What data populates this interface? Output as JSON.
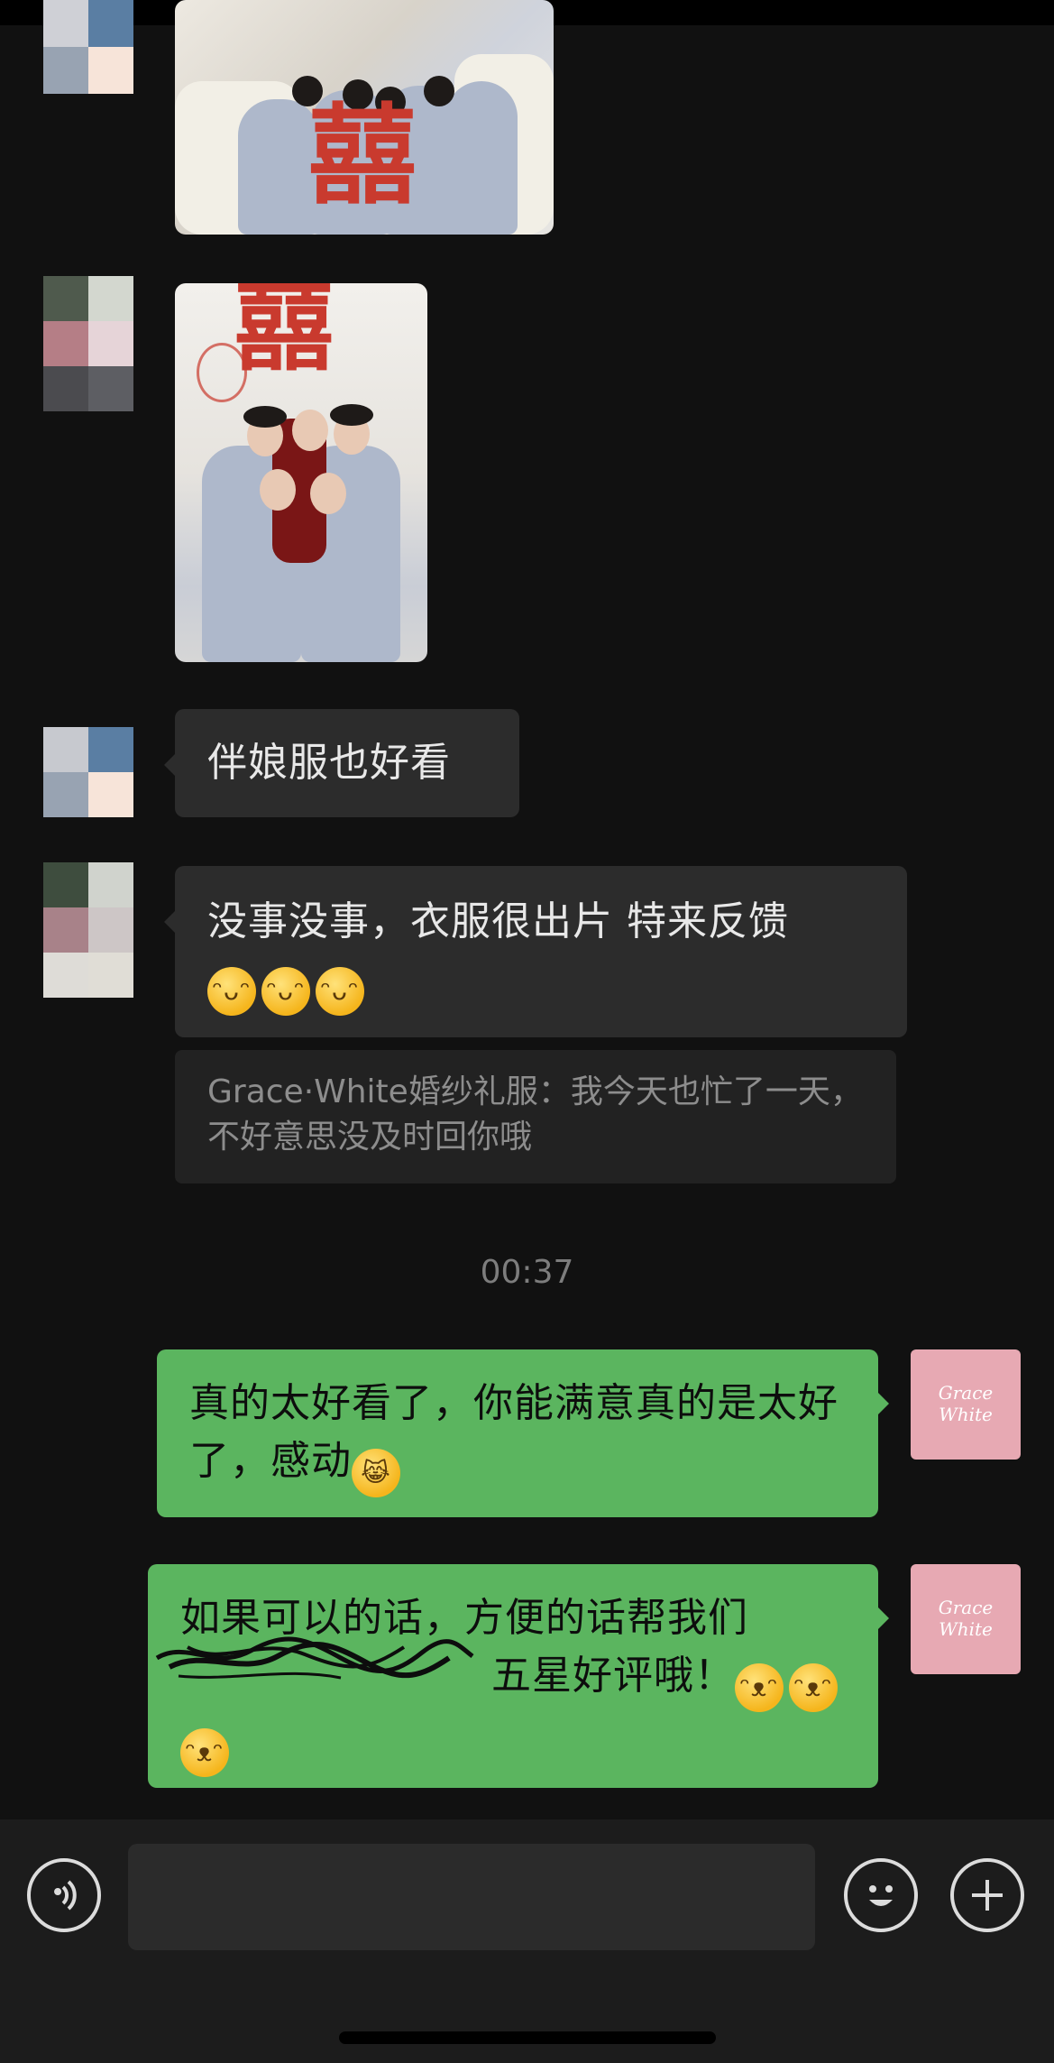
{
  "chat": {
    "messages": [
      {
        "type": "image",
        "from": "other"
      },
      {
        "type": "image",
        "from": "other"
      },
      {
        "type": "text",
        "from": "other",
        "text": "伴娘服也好看"
      },
      {
        "type": "text",
        "from": "other",
        "text": "没事没事，衣服很出片 特来反馈",
        "emoji": [
          "grin",
          "grin",
          "grin"
        ]
      },
      {
        "type": "quote",
        "from": "other",
        "text": "Grace·White婚纱礼服：我今天也忙了一天，不好意思没及时回你哦"
      },
      {
        "type": "timestamp",
        "text": "00:37"
      },
      {
        "type": "text",
        "from": "me",
        "text": "真的太好看了，你能满意真的是太好了，感动",
        "emoji": [
          "tears-of-joy"
        ]
      },
      {
        "type": "text",
        "from": "me",
        "text_line1": "如果可以的话，方便的话帮我们",
        "text_line2_visible": "五星好评哦！",
        "emoji": [
          "peek",
          "peek",
          "peek"
        ]
      }
    ],
    "photo_text": {
      "xi_char": "囍"
    },
    "shop_avatar": {
      "line1": "Grace",
      "line2": "White"
    }
  },
  "input_bar": {
    "voice_icon": "voice-icon",
    "emoji_icon": "smile-icon",
    "plus_icon": "plus-icon",
    "input_value": ""
  },
  "colors": {
    "background": "#111111",
    "incoming_bubble": "#2c2c2c",
    "outgoing_bubble": "#5bb55f",
    "shop_avatar": "#e7a9b3"
  }
}
